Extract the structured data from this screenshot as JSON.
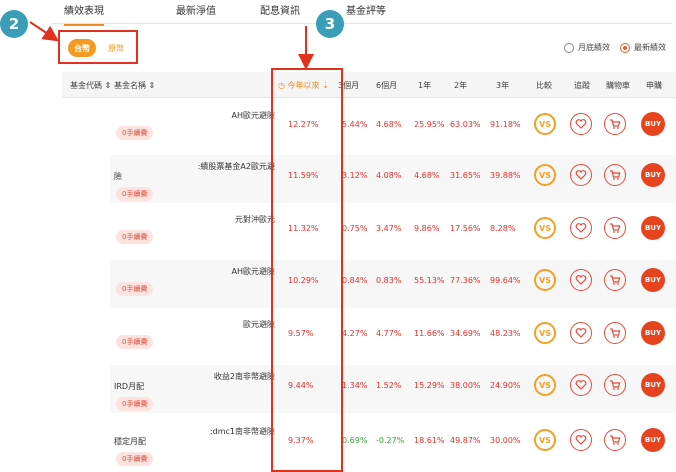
{
  "tabs": [
    "績效表現",
    "最新淨值",
    "配息資訊",
    "基金評等"
  ],
  "step_badges": [
    "2",
    "3"
  ],
  "currency": {
    "twd": "台幣",
    "original": "原幣"
  },
  "radios": [
    {
      "label": "月底績效",
      "checked": false
    },
    {
      "label": "最新績效",
      "checked": true
    }
  ],
  "headers": {
    "code": "基金代碼",
    "name": "基金名稱",
    "ytd": "今年以來",
    "m3": "3個月",
    "m6": "6個月",
    "y1": "1年",
    "y2": "2年",
    "y3": "3年",
    "compare": "比較",
    "track": "追蹤",
    "cart": "購物車",
    "apply": "申購"
  },
  "fee_label": "0手續費",
  "vs_label": "VS",
  "buy_label": "BUY",
  "colors": {
    "accent": "#f08a24",
    "red": "#e0322e",
    "green": "#3aa43a",
    "teal": "#3b9eb8"
  },
  "rows": [
    {
      "name1": "AH歐元避險",
      "name2": "",
      "ytd": "12.27%",
      "m3": "5.44%",
      "m6": "4.68%",
      "y1": "25.95%",
      "y2": "63.03%",
      "y3": "91.18%"
    },
    {
      "name1": ":績股票基金A2歐元避",
      "name2": "險",
      "ytd": "11.59%",
      "m3": "3.12%",
      "m6": "4.08%",
      "y1": "4.68%",
      "y2": "31.65%",
      "y3": "39.88%"
    },
    {
      "name1": "元對沖歐元",
      "name2": "",
      "ytd": "11.32%",
      "m3": "0.75%",
      "m6": "3.47%",
      "y1": "9.86%",
      "y2": "17.56%",
      "y3": "8.28%"
    },
    {
      "name1": "AH歐元避險",
      "name2": "",
      "ytd": "10.29%",
      "m3": "0.84%",
      "m6": "0.83%",
      "y1": "55.13%",
      "y2": "77.36%",
      "y3": "99.64%"
    },
    {
      "name1": "歐元避險",
      "name2": "",
      "ytd": "9.57%",
      "m3": "4.27%",
      "m6": "4.77%",
      "y1": "11.66%",
      "y2": "34.69%",
      "y3": "48.23%"
    },
    {
      "name1": "收益2南非幣避險",
      "name2": "IRD月配",
      "ytd": "9.44%",
      "m3": "1.34%",
      "m6": "1.52%",
      "y1": "15.29%",
      "y2": "38.00%",
      "y3": "24.90%"
    },
    {
      "name1": ":dmc1南非幣避險",
      "name2": "穩定月配",
      "ytd": "9.37%",
      "m3": "0.69%",
      "m6": "-0.27%",
      "y1": "18.61%",
      "y2": "49.87%",
      "y3": "30.00%"
    }
  ]
}
